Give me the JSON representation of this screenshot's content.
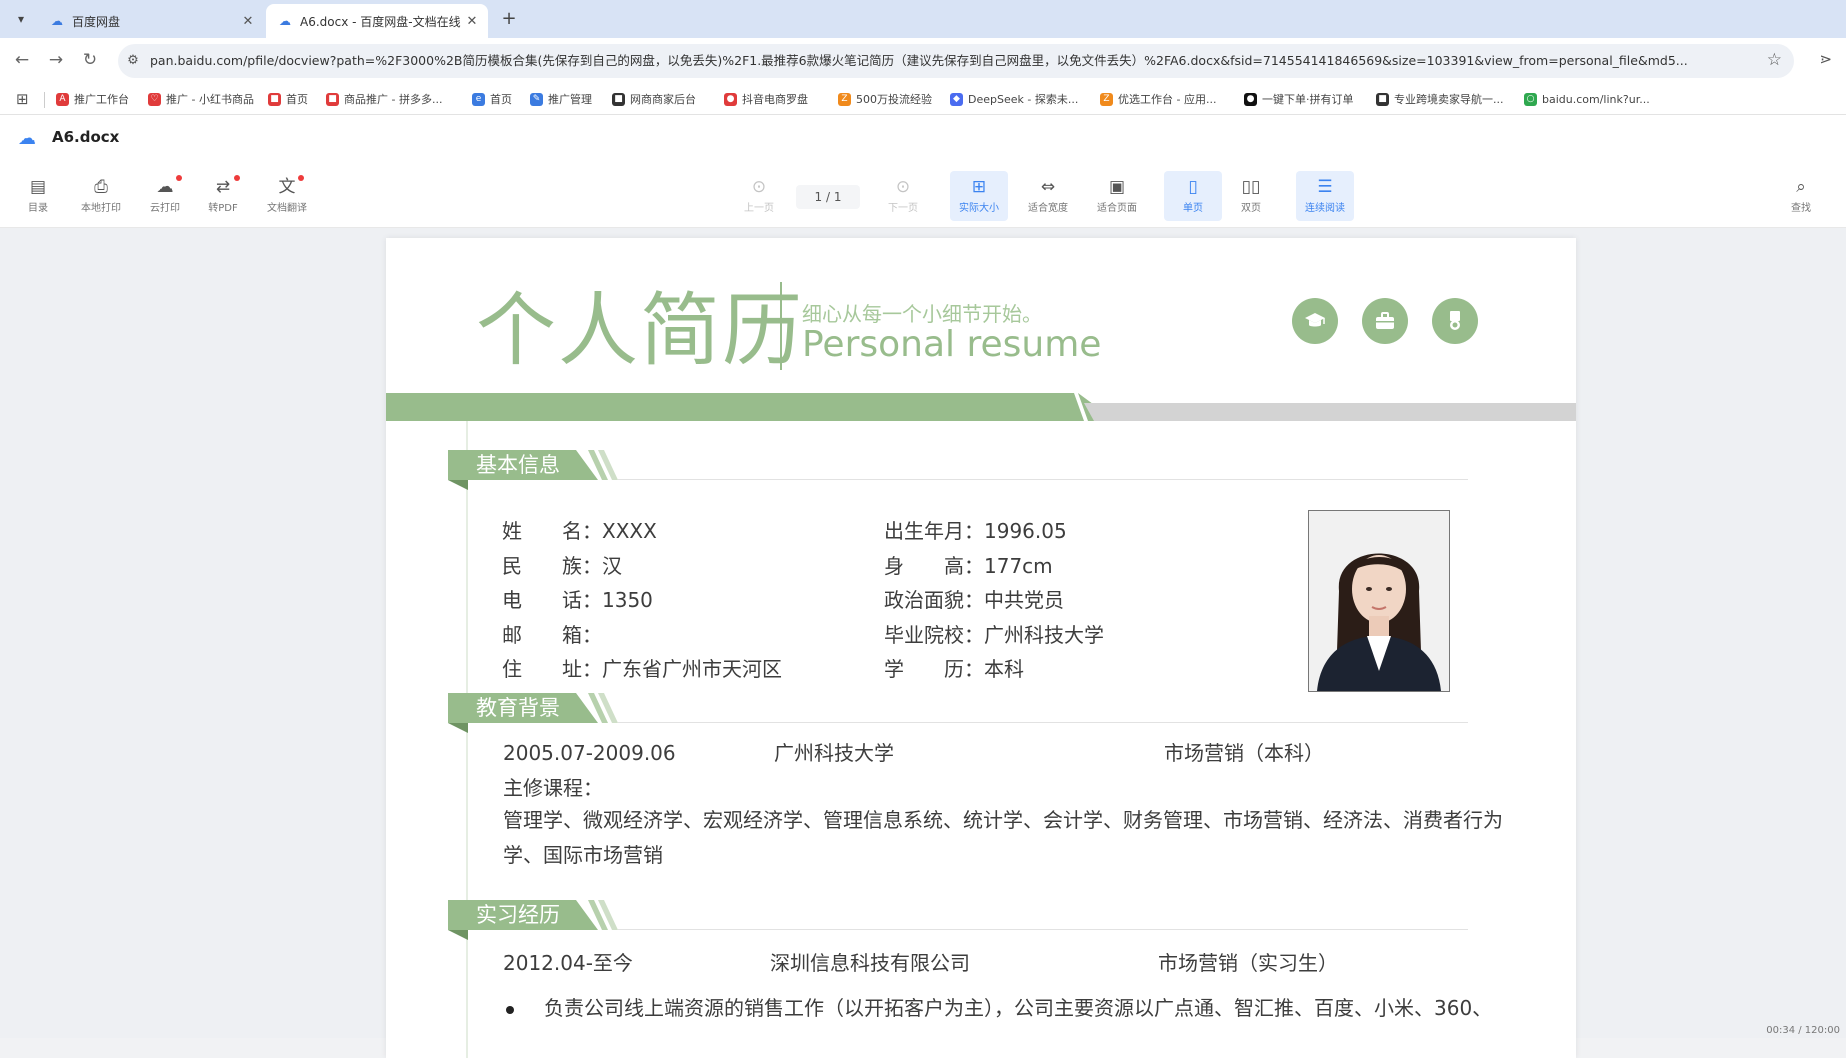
{
  "browser": {
    "tabs": [
      {
        "title": "百度网盘",
        "active": false
      },
      {
        "title": "A6.docx - 百度网盘-文档在线",
        "active": true
      }
    ],
    "url": "pan.baidu.com/pfile/docview?path=%2F3000%2B简历模板合集(先保存到自己的网盘，以免丢失)%2F1.最推荐6款爆火笔记简历（建议先保存到自己网盘里，以免文件丢失）%2FA6.docx&fsid=714554141846569&size=103391&view_from=personal_file&md5...",
    "bookmarks": [
      {
        "label": "推广工作台",
        "icon": "A",
        "color": "#e03b3b"
      },
      {
        "label": "推广 - 小红书商品",
        "icon": "♡",
        "color": "#e03b3b"
      },
      {
        "label": "首页",
        "icon": "■",
        "color": "#e03b3b"
      },
      {
        "label": "商品推广 - 拼多多...",
        "icon": "■",
        "color": "#e03b3b"
      },
      {
        "label": "首页",
        "icon": "e",
        "color": "#3b7be0"
      },
      {
        "label": "推广管理",
        "icon": "✎",
        "color": "#3b7be0"
      },
      {
        "label": "网商商家后台",
        "icon": "■",
        "color": "#333333"
      },
      {
        "label": "抖音电商罗盘",
        "icon": "●",
        "color": "#e03b3b"
      },
      {
        "label": "500万投流经验",
        "icon": "Z",
        "color": "#f08a1c"
      },
      {
        "label": "DeepSeek - 探索未...",
        "icon": "◆",
        "color": "#4b6cf0"
      },
      {
        "label": "优选工作台 - 应用...",
        "icon": "Z",
        "color": "#f08a1c"
      },
      {
        "label": "一键下单·拼有订单",
        "icon": "●",
        "color": "#111111"
      },
      {
        "label": "专业跨境卖家导航一...",
        "icon": "■",
        "color": "#333333"
      },
      {
        "label": "baidu.com/link?ur...",
        "icon": "○",
        "color": "#2fa84f"
      }
    ]
  },
  "app": {
    "filename": "A6.docx",
    "toolbar_left": [
      {
        "label": "目录",
        "icon": "▤",
        "dot": false
      },
      {
        "label": "本地打印",
        "icon": "⎙",
        "dot": false
      },
      {
        "label": "云打印",
        "icon": "☁",
        "dot": true
      },
      {
        "label": "转PDF",
        "icon": "⇄",
        "dot": true
      },
      {
        "label": "文档翻译",
        "icon": "文",
        "dot": true
      }
    ],
    "prev_label": "上一页",
    "next_label": "下一页",
    "page_indicator": "1 / 1",
    "view_tools": [
      {
        "label": "实际大小",
        "icon": "⊞",
        "active": true
      },
      {
        "label": "适合宽度",
        "icon": "⇔",
        "active": false
      },
      {
        "label": "适合页面",
        "icon": "▣",
        "active": false
      },
      {
        "label": "单页",
        "icon": "▯",
        "active": true
      },
      {
        "label": "双页",
        "icon": "▯▯",
        "active": false
      },
      {
        "label": "连续阅读",
        "icon": "☰",
        "active": true
      }
    ],
    "search_label": "查找"
  },
  "resume": {
    "title_cn": "个人简历",
    "slogan": "细心从每一个小细节开始。",
    "title_en": "Personal resume",
    "accent_color": "#98bc8c",
    "badges": [
      "graduation-cap-icon",
      "briefcase-icon",
      "medal-icon"
    ],
    "sections": {
      "basic": "基本信息",
      "education": "教育背景",
      "internship": "实习经历"
    },
    "basic_left": [
      {
        "k": "姓　　名",
        "v": "XXXX"
      },
      {
        "k": "民　　族",
        "v": "汉"
      },
      {
        "k": "电　　话",
        "v": "1350"
      },
      {
        "k": "邮　　箱",
        "v": ""
      },
      {
        "k": "住　　址",
        "v": "广东省广州市天河区"
      }
    ],
    "basic_right": [
      {
        "k": "出生年月",
        "v": "1996.05"
      },
      {
        "k": "身　　高",
        "v": "177cm"
      },
      {
        "k": "政治面貌",
        "v": "中共党员"
      },
      {
        "k": "毕业院校",
        "v": "广州科技大学"
      },
      {
        "k": "学　　历",
        "v": "本科"
      }
    ],
    "education": {
      "period": "2005.07-2009.06",
      "school": "广州科技大学",
      "major": "市场营销（本科）",
      "courses_label": "主修课程：",
      "courses": "管理学、微观经济学、宏观经济学、管理信息系统、统计学、会计学、财务管理、市场营销、经济法、消费者行为学、国际市场营销"
    },
    "internship": {
      "period": "2012.04-至今",
      "company": "深圳信息科技有限公司",
      "role": "市场营销（实习生）",
      "bullet1": "负责公司线上端资源的销售工作（以开拓客户为主），公司主要资源以广点通、智汇推、百度、小米、360、"
    }
  },
  "corner_time": "00:34 / 120:00"
}
